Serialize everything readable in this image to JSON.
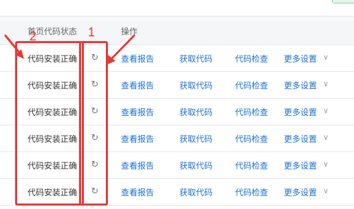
{
  "table": {
    "headers": {
      "status": "首页代码状态",
      "ops": "操作"
    },
    "rows": [
      {
        "status": "代码安装正确",
        "report": "查看报告",
        "get_code": "获取代码",
        "check": "代码检查",
        "more": "更多设置"
      },
      {
        "status": "代码安装正确",
        "report": "查看报告",
        "get_code": "获取代码",
        "check": "代码检查",
        "more": "更多设置"
      },
      {
        "status": "代码安装正确",
        "report": "查看报告",
        "get_code": "获取代码",
        "check": "代码检查",
        "more": "更多设置"
      },
      {
        "status": "代码安装正确",
        "report": "查看报告",
        "get_code": "获取代码",
        "check": "代码检查",
        "more": "更多设置"
      },
      {
        "status": "代码安装正确",
        "report": "查看报告",
        "get_code": "获取代码",
        "check": "代码检查",
        "more": "更多设置"
      },
      {
        "status": "代码安装正确",
        "report": "查看报告",
        "get_code": "获取代码",
        "check": "代码检查",
        "more": "更多设置"
      }
    ]
  },
  "annotations": {
    "label_1": "1",
    "label_2": "2",
    "color": "#e53935"
  },
  "icons": {
    "refresh": "refresh-icon",
    "more": "chevron-down-icon"
  },
  "colors": {
    "link": "#1a6fd6",
    "header_bg": "#f5f6f8",
    "highlight_row": "#eef3fb"
  }
}
